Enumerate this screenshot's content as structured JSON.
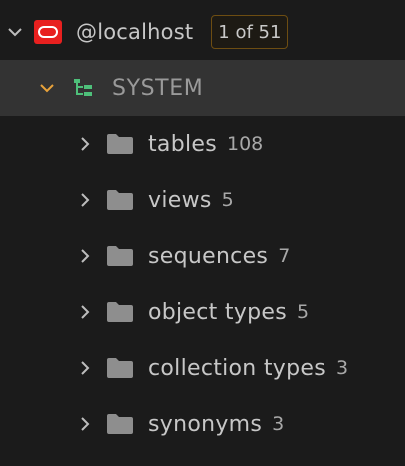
{
  "connection": {
    "label": "@localhost",
    "page_badge": "1 of 51",
    "logo": "oracle-logo-icon",
    "logo_color": "#e8201f"
  },
  "schema": {
    "label": "SYSTEM",
    "icon": "schema-tree-icon",
    "icon_color": "#4ec07a",
    "chevron_color": "#e8a23a"
  },
  "items": [
    {
      "label": "tables",
      "count": "108"
    },
    {
      "label": "views",
      "count": "5"
    },
    {
      "label": "sequences",
      "count": "7"
    },
    {
      "label": "object types",
      "count": "5"
    },
    {
      "label": "collection types",
      "count": "3"
    },
    {
      "label": "synonyms",
      "count": "3"
    }
  ],
  "colors": {
    "background": "#1b1b1b",
    "selected_row": "#333333",
    "badge_border": "#6d4d12",
    "folder": "#8e8e8e"
  }
}
